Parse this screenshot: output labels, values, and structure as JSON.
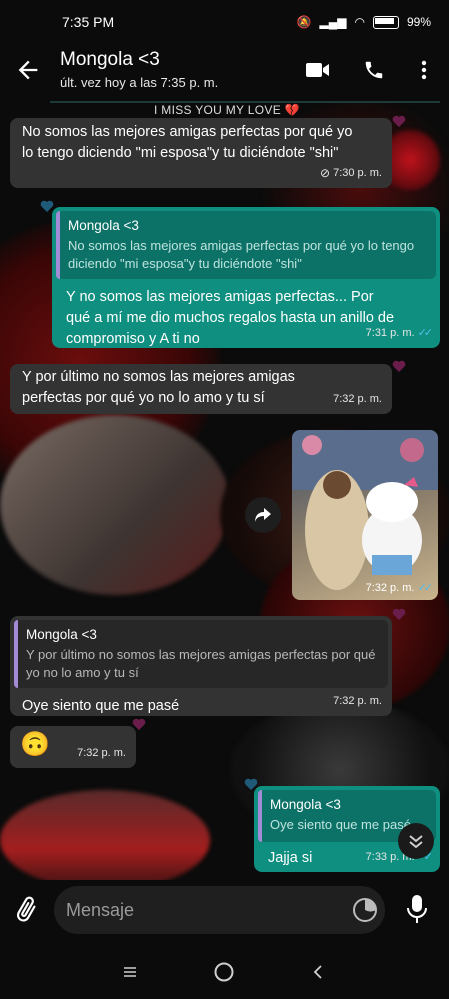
{
  "status": {
    "time": "7:35 PM",
    "battery": "99%"
  },
  "header": {
    "title": "Mongola <3",
    "subtitle": "últ. vez hoy a las 7:35 p. m."
  },
  "banner": "I MISS YOU  MY LOVE 💔",
  "messages": [
    {
      "type": "in",
      "text": "No somos las mejores amigas perfectas por qué yo\nlo tengo diciendo \"mi esposa\"y tu diciéndote \"shi\"",
      "time": "7:30 p. m."
    },
    {
      "type": "out",
      "quote_author": "Mongola <3",
      "quote_text": "No somos las mejores amigas perfectas por qué yo lo tengo diciendo \"mi esposa\"y tu diciéndote \"shi\"",
      "text": "Y no somos las mejores amigas perfectas... Por\nqué a mí me dio muchos regalos hasta un anillo de\ncompromiso y A ti  no",
      "time": "7:31 p. m."
    },
    {
      "type": "in",
      "text": "Y por último no somos las mejores amigas\nperfectas por qué yo no lo amo y tu sí",
      "time": "7:32 p. m."
    },
    {
      "type": "out_image",
      "time": "7:32 p. m."
    },
    {
      "type": "in",
      "quote_author": "Mongola <3",
      "quote_text": "Y por último no somos las mejores amigas perfectas por qué yo no lo amo y tu sí",
      "text": "Oye siento que me pasé",
      "time": "7:32 p. m."
    },
    {
      "type": "in",
      "text": "🙃",
      "time": "7:32 p. m."
    },
    {
      "type": "out",
      "quote_author": "Mongola <3",
      "quote_text": "Oye siento que me pasé",
      "text": "Jajja si",
      "time": "7:33 p. m."
    }
  ],
  "input": {
    "placeholder": "Mensaje"
  },
  "colors": {
    "outgoing": "#0f8f80",
    "incoming": "#333333",
    "read_ticks": "#53bdeb"
  }
}
